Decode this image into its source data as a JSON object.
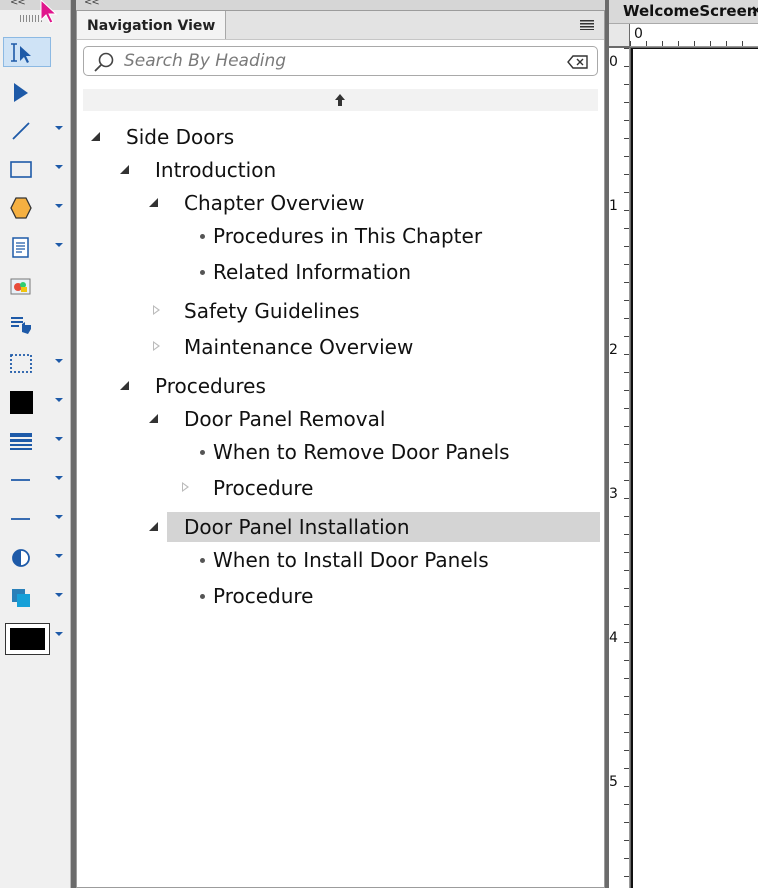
{
  "toolbar": {
    "collapse_glyph": "<<",
    "tools": [
      {
        "name": "text-select-tool",
        "icon": "text-select-icon",
        "active": true,
        "dropdown": false
      },
      {
        "name": "arrow-tool",
        "icon": "arrow-pointer-icon",
        "dropdown": false
      },
      {
        "name": "line-tool",
        "icon": "line-icon",
        "dropdown": true
      },
      {
        "name": "rectangle-tool",
        "icon": "rectangle-icon",
        "dropdown": true
      },
      {
        "name": "polygon-tool",
        "icon": "hexagon-icon",
        "dropdown": true
      },
      {
        "name": "text-frame-tool",
        "icon": "document-icon",
        "dropdown": true
      },
      {
        "name": "image-tool",
        "icon": "image-icon",
        "dropdown": false
      },
      {
        "name": "hotspot-tool",
        "icon": "hand-list-icon",
        "dropdown": false
      },
      {
        "name": "selection-frame-tool",
        "icon": "dotted-rectangle-icon",
        "dropdown": true
      },
      {
        "name": "fill-color-tool",
        "icon": "black-square-icon",
        "dropdown": true
      },
      {
        "name": "line-weight-tool",
        "icon": "line-weight-icon",
        "dropdown": true
      },
      {
        "name": "line-style-tool",
        "icon": "line-style-icon",
        "dropdown": true
      },
      {
        "name": "dash-style-tool",
        "icon": "dash-line-icon",
        "dropdown": true
      },
      {
        "name": "tint-tool",
        "icon": "half-circle-icon",
        "dropdown": true
      },
      {
        "name": "overprint-tool",
        "icon": "overlap-squares-icon",
        "dropdown": true
      },
      {
        "name": "color-swatch-tool",
        "icon": "color-swatch-icon",
        "dropdown": true
      }
    ]
  },
  "nav_panel": {
    "collapse_glyph": "<<",
    "title": "Navigation View",
    "search": {
      "placeholder": "Search By Heading",
      "value": ""
    },
    "tree": [
      {
        "label": "Side Doors",
        "level": 0,
        "state": "expanded"
      },
      {
        "label": "Introduction",
        "level": 1,
        "state": "expanded"
      },
      {
        "label": "Chapter Overview",
        "level": 2,
        "state": "expanded"
      },
      {
        "label": "Procedures in This Chapter",
        "level": 3,
        "state": "leaf"
      },
      {
        "label": "Related Information",
        "level": 3,
        "state": "leaf"
      },
      {
        "label": "Safety Guidelines",
        "level": 2,
        "state": "collapsed"
      },
      {
        "label": "Maintenance Overview",
        "level": 2,
        "state": "collapsed"
      },
      {
        "label": "Procedures",
        "level": 1,
        "state": "expanded"
      },
      {
        "label": "Door Panel Removal",
        "level": 2,
        "state": "expanded"
      },
      {
        "label": "When to Remove Door Panels",
        "level": 3,
        "state": "leaf"
      },
      {
        "label": "Procedure",
        "level": 3,
        "state": "collapsed"
      },
      {
        "label": "Door Panel Installation",
        "level": 2,
        "state": "expanded",
        "selected": true
      },
      {
        "label": "When to Install Door Panels",
        "level": 3,
        "state": "leaf"
      },
      {
        "label": "Procedure",
        "level": 3,
        "state": "leaf"
      }
    ]
  },
  "document": {
    "tab_title": "WelcomeScreen",
    "tab_close": "×",
    "ruler_h_labels": [
      "0"
    ],
    "ruler_v_labels": [
      "0",
      "1",
      "2",
      "3",
      "4",
      "5"
    ]
  },
  "colors": {
    "accent": "#1e5aa8",
    "selection": "#d4d4d4",
    "cursor": "#e0168c"
  }
}
